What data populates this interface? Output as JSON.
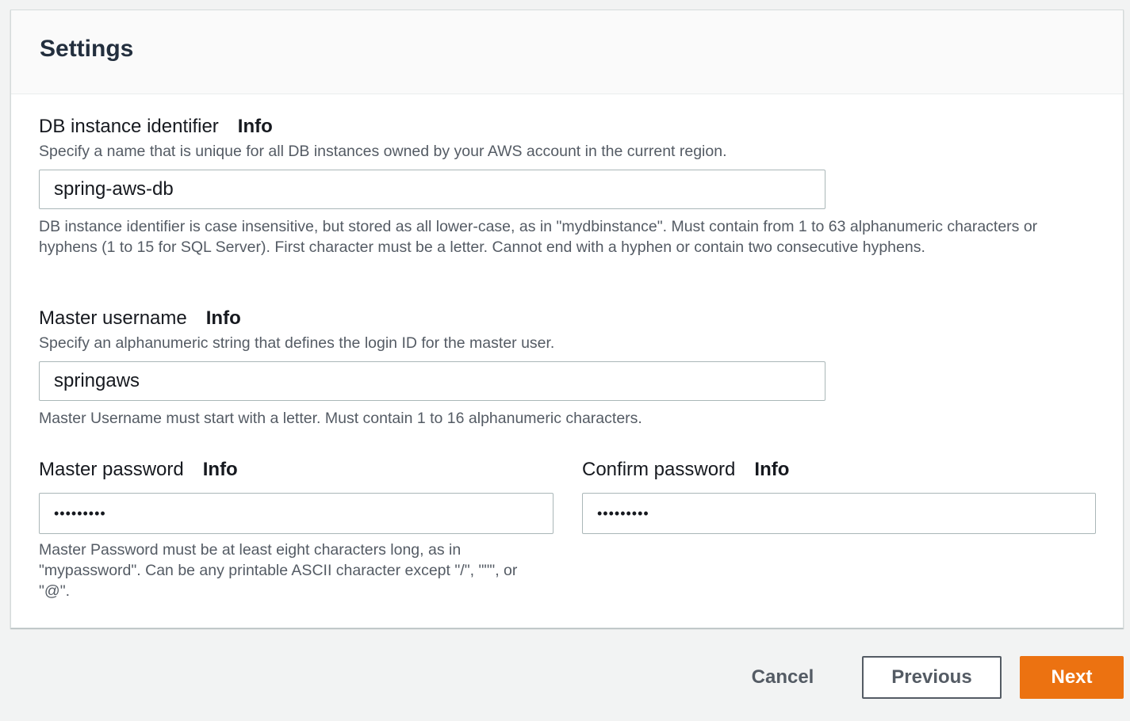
{
  "panel": {
    "title": "Settings"
  },
  "db_identifier": {
    "label": "DB instance identifier",
    "info": "Info",
    "description": "Specify a name that is unique for all DB instances owned by your AWS account in the current region.",
    "value": "spring-aws-db",
    "constraint": "DB instance identifier is case insensitive, but stored as all lower-case, as in \"mydbinstance\". Must contain from 1 to 63 alphanumeric characters or hyphens (1 to 15 for SQL Server). First character must be a letter. Cannot end with a hyphen or contain two consecutive hyphens."
  },
  "master_username": {
    "label": "Master username",
    "info": "Info",
    "description": "Specify an alphanumeric string that defines the login ID for the master user.",
    "value": "springaws",
    "constraint": "Master Username must start with a letter. Must contain 1 to 16 alphanumeric characters."
  },
  "master_password": {
    "label": "Master password",
    "info": "Info",
    "value": "•••••••••",
    "constraint": "Master Password must be at least eight characters long, as in \"mypassword\". Can be any printable ASCII character except \"/\", \"\"\", or \"@\"."
  },
  "confirm_password": {
    "label": "Confirm password",
    "info": "Info",
    "value": "•••••••••"
  },
  "actions": {
    "cancel": "Cancel",
    "previous": "Previous",
    "next": "Next"
  },
  "colors": {
    "primary_button": "#ec7211",
    "page_background": "#f2f3f3",
    "panel_header": "#fafafa"
  }
}
